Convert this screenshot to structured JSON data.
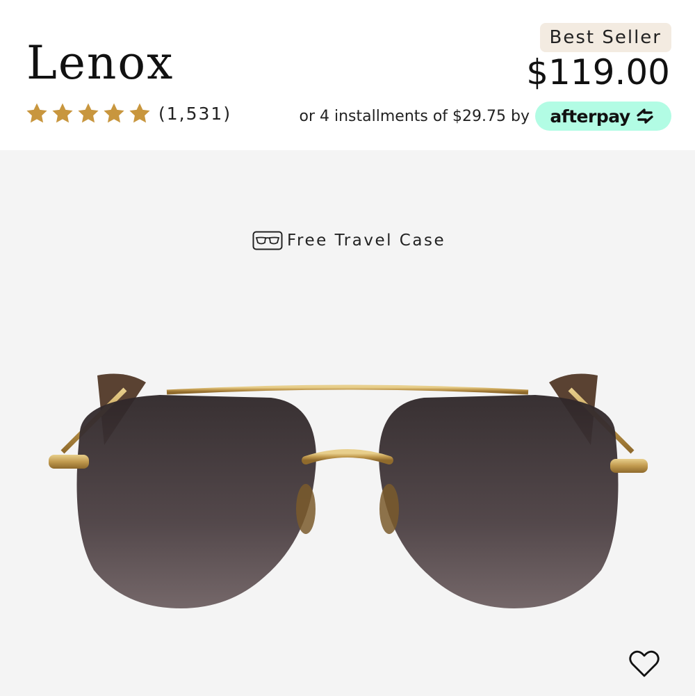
{
  "product": {
    "name": "Lenox",
    "rating": 5,
    "review_count": "(1,531)",
    "badge": "Best Seller",
    "price": "$119.00",
    "installments_text": "or 4 installments of $29.75 by",
    "afterpay_label": "afterpay",
    "perk": "Free Travel Case"
  },
  "colors": {
    "star": "#c8963e",
    "badge_bg": "#f3ebe1",
    "afterpay_mint": "#b2fce4",
    "gallery_bg": "#f4f4f4",
    "frame_gold": "#c9a35a",
    "lens_dark": "#3e3436"
  },
  "icons": {
    "star": "star-icon",
    "case": "glasses-case-icon",
    "wishlist": "heart-icon",
    "afterpay": "afterpay-logo-icon"
  }
}
